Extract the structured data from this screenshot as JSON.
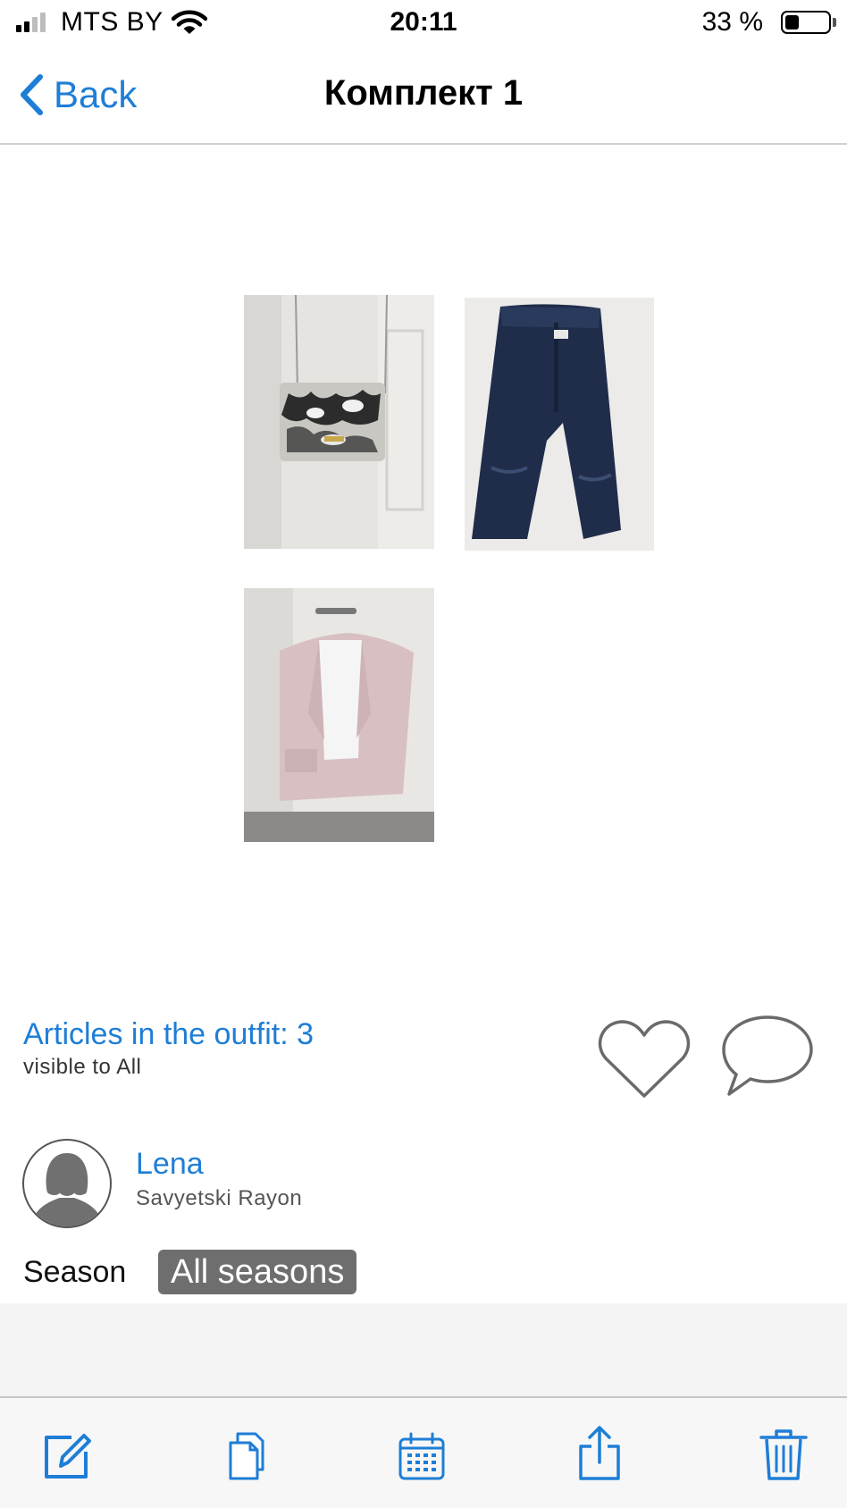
{
  "status_bar": {
    "carrier": "MTS BY",
    "time": "20:11",
    "battery": "33 %",
    "battery_level": 0.33
  },
  "nav": {
    "back_label": "Back",
    "title": "Комплект 1"
  },
  "outfit_items": [
    {
      "kind": "snake-print crossbody bag"
    },
    {
      "kind": "dark blue jeans"
    },
    {
      "kind": "pink blazer with white top"
    }
  ],
  "info": {
    "articles": "Articles in the outfit: 3",
    "visibility": "visible to All"
  },
  "user": {
    "name": "Lena",
    "location": "Savyetski Rayon"
  },
  "season": {
    "label": "Season",
    "value": "All seasons"
  },
  "toolbar": {
    "items": [
      "edit-icon",
      "copy-icon",
      "calendar-icon",
      "share-icon",
      "trash-icon"
    ]
  },
  "colors": {
    "accent": "#1e7ed6",
    "badge": "#6e6e6e"
  }
}
